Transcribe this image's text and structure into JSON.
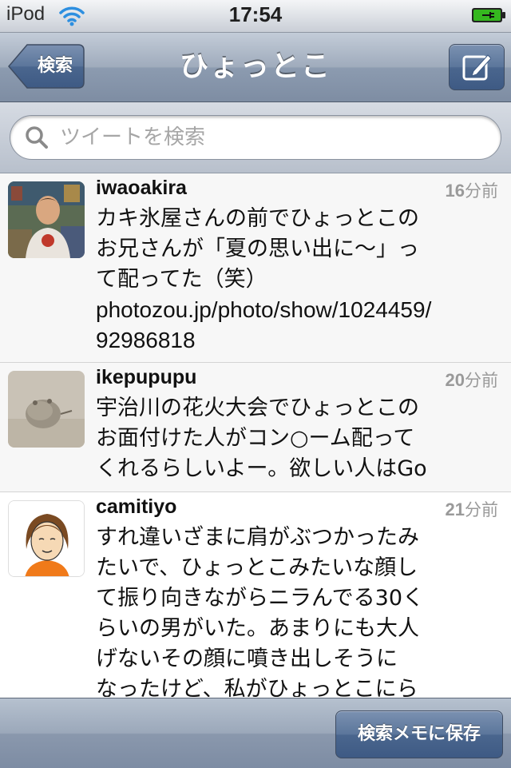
{
  "status_bar": {
    "carrier": "iPod",
    "time": "17:54",
    "wifi_icon": "wifi-icon",
    "battery_icon": "battery-charging-icon"
  },
  "nav": {
    "back_label": "検索",
    "title": "ひょっとこ",
    "compose_icon": "compose-icon"
  },
  "search": {
    "placeholder": "ツイートを検索",
    "icon": "search-icon"
  },
  "tweets": [
    {
      "username": "iwaoakira",
      "time_value": "16",
      "time_unit": "分前",
      "lines": [
        "カキ氷屋さんの前でひょっとこの",
        "お兄さんが「夏の思い出に〜」っ",
        "て配ってた（笑）",
        "photozou.jp/photo/show/1024459/",
        "92986818"
      ]
    },
    {
      "username": "ikepupupu",
      "time_value": "20",
      "time_unit": "分前",
      "lines": [
        "宇治川の花火大会でひょっとこの",
        "お面付けた人がコン○ーム配って",
        "くれるらしいよー。欲しい人はGo"
      ]
    },
    {
      "username": "camitiyo",
      "time_value": "21",
      "time_unit": "分前",
      "lines": [
        "すれ違いざまに肩がぶつかったみ",
        "たいで、ひょっとこみたいな顔し",
        "て振り向きながらニラんでる30く",
        "らいの男がいた。あまりにも大人",
        "げないその顔に噴き出しそうに",
        "なったけど、私がひょっとこにら"
      ]
    }
  ],
  "toolbar": {
    "save_label": "検索メモに保存"
  },
  "colors": {
    "nav_blue": "#5b769b",
    "time_gray": "#9a9a9a",
    "placeholder_gray": "#a6a6a6"
  }
}
